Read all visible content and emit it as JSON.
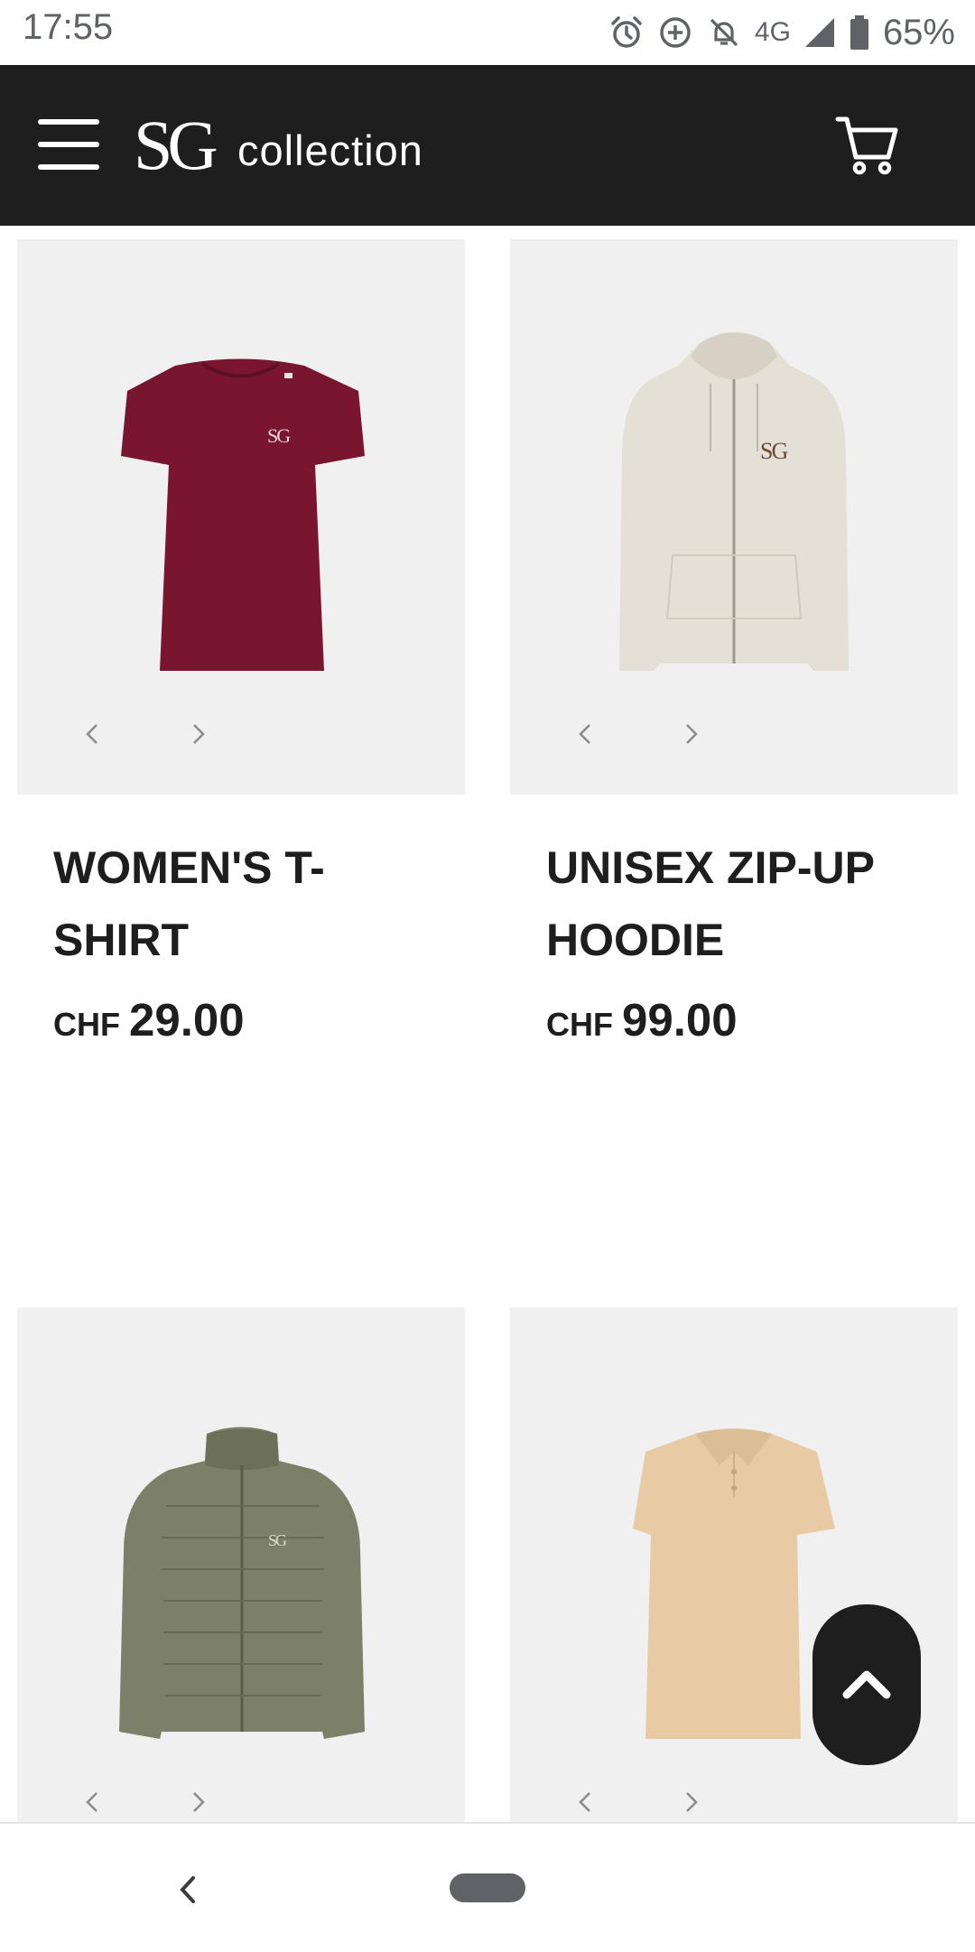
{
  "status_bar": {
    "time": "17:55",
    "network": "4G",
    "battery": "65%",
    "icons": [
      "alarm-icon",
      "data-saver-icon",
      "notifications-off-icon",
      "signal-icon",
      "battery-icon"
    ]
  },
  "header": {
    "logo_mark": "SG",
    "logo_text": "collection",
    "menu_icon": "hamburger-menu-icon",
    "cart_icon": "shopping-cart-icon",
    "background": "#1e1e1e"
  },
  "products": [
    {
      "title": "WOMEN'S T-SHIRT",
      "currency": "CHF",
      "price": "29.00",
      "color": "#7a1530"
    },
    {
      "title": "UNISEX ZIP-UP HOODIE",
      "currency": "CHF",
      "price": "99.00",
      "color": "#e4e0d6"
    },
    {
      "title": "",
      "currency": "",
      "price": "",
      "color": "#7d8068"
    },
    {
      "title": "",
      "currency": "",
      "price": "",
      "color": "#e8cba5"
    }
  ],
  "garment_logo": "SG",
  "scroll_top_icon": "chevron-up-icon",
  "nav_bar": {
    "back_icon": "back-chevron-icon",
    "home_icon": "home-pill-icon"
  }
}
